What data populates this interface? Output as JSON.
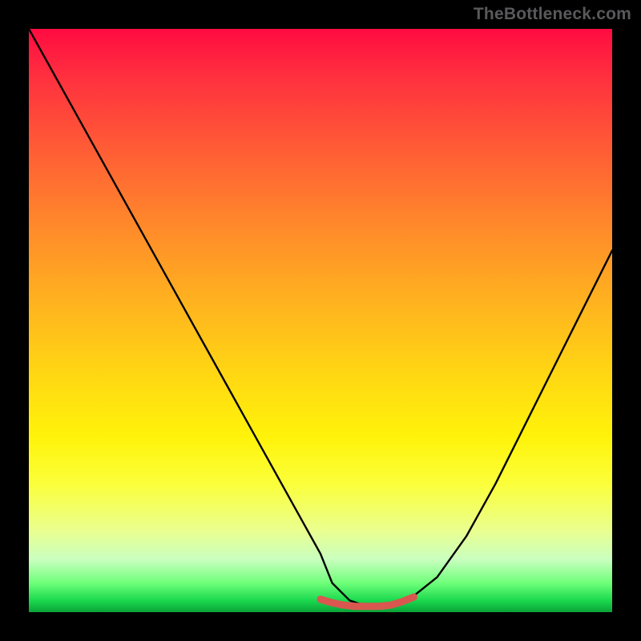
{
  "watermark": "TheBottleneck.com",
  "chart_data": {
    "type": "line",
    "title": "",
    "xlabel": "",
    "ylabel": "",
    "xlim": [
      0,
      100
    ],
    "ylim": [
      0,
      100
    ],
    "grid": false,
    "legend": false,
    "series": [
      {
        "name": "main-curve",
        "color": "#000000",
        "x": [
          0,
          5,
          10,
          15,
          20,
          25,
          30,
          35,
          40,
          45,
          50,
          52,
          55,
          58,
          60,
          62,
          65,
          70,
          75,
          80,
          85,
          90,
          95,
          100
        ],
        "y": [
          100,
          91,
          82,
          73,
          64,
          55,
          46,
          37,
          28,
          19,
          10,
          5,
          2,
          1,
          1,
          1,
          2,
          6,
          13,
          22,
          32,
          42,
          52,
          62
        ]
      },
      {
        "name": "floor-band",
        "color": "#d9574f",
        "x": [
          50,
          52,
          54,
          56,
          58,
          60,
          62,
          64,
          66
        ],
        "y": [
          2.2,
          1.6,
          1.2,
          1.0,
          1.0,
          1.0,
          1.2,
          1.8,
          2.6
        ]
      }
    ],
    "annotations": []
  },
  "colors": {
    "background": "#000000",
    "watermark": "#59595b",
    "curve": "#000000",
    "band": "#d9574f"
  }
}
